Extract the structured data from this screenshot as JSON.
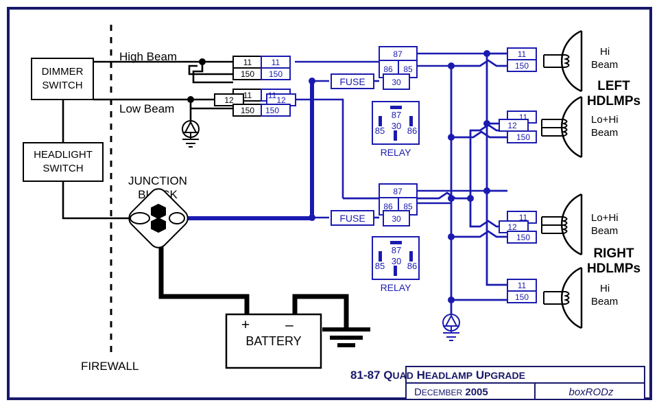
{
  "meta": {
    "border_color": "#18186a",
    "wire_black": "#000000",
    "wire_blue": "#1a1ab0",
    "bg": "#ffffff"
  },
  "left_panel": {
    "dimmer_switch": {
      "line1": "DIMMER",
      "line2": "SWITCH"
    },
    "headlight_switch": {
      "line1": "HEADLIGHT",
      "line2": "SWITCH"
    },
    "high_beam_label": "High Beam",
    "low_beam_label": "Low Beam",
    "junction_block": {
      "line1": "JUNCTION",
      "line2": "BLOCK"
    },
    "firewall_label": "FIREWALL",
    "battery": {
      "plus": "+",
      "minus": "–",
      "label": "BATTERY"
    }
  },
  "connectors": {
    "dimmer_high": {
      "top": "11",
      "bottom": "150"
    },
    "dimmer_low": {
      "top": "11",
      "mid": "12",
      "bottom": "150"
    },
    "harness_high": {
      "top": "11",
      "bottom": "150"
    },
    "harness_low": {
      "top": "11",
      "mid": "12",
      "bottom": "150"
    },
    "lamp_left_hi": {
      "top": "11",
      "bottom": "150"
    },
    "lamp_left_lohi": {
      "top": "11",
      "mid": "12",
      "bottom": "150"
    },
    "lamp_right_lohi": {
      "top": "11",
      "mid": "12",
      "bottom": "150"
    },
    "lamp_right_hi": {
      "top": "11",
      "bottom": "150"
    }
  },
  "fuses": {
    "upper_label": "FUSE",
    "lower_label": "FUSE"
  },
  "relays": [
    {
      "name": "upper-relay",
      "schematic_terminals": {
        "t87": "87",
        "t86": "86",
        "t85": "85",
        "t30": "30"
      },
      "pinout_terminals": {
        "t87": "87",
        "t85": "85",
        "t30": "30",
        "t86": "86"
      },
      "caption": "RELAY"
    },
    {
      "name": "lower-relay",
      "schematic_terminals": {
        "t87": "87",
        "t86": "86",
        "t85": "85",
        "t30": "30"
      },
      "pinout_terminals": {
        "t87": "87",
        "t85": "85",
        "t30": "30",
        "t86": "86"
      },
      "caption": "RELAY"
    }
  ],
  "lamps": [
    {
      "name": "left-hi",
      "beam_line1": "Hi",
      "beam_line2": "Beam",
      "filaments": 1
    },
    {
      "name": "left-lohi",
      "beam_line1": "Lo+Hi",
      "beam_line2": "Beam",
      "filaments": 2
    },
    {
      "name": "right-lohi",
      "beam_line1": "Lo+Hi",
      "beam_line2": "Beam",
      "filaments": 2
    },
    {
      "name": "right-hi",
      "beam_line1": "Hi",
      "beam_line2": "Beam",
      "filaments": 1
    }
  ],
  "lamp_groups": {
    "left": {
      "line1": "LEFT",
      "line2": "HDLMPs"
    },
    "right": {
      "line1": "RIGHT",
      "line2": "HDLMPs"
    }
  },
  "title_block": {
    "title_parts": [
      {
        "big": "81-87",
        "rest": ""
      },
      {
        "big": "Q",
        "rest": "UAD"
      },
      {
        "big": "H",
        "rest": "EADLAMP"
      },
      {
        "big": "U",
        "rest": "PGRADE"
      }
    ],
    "title_plain": "81-87 QUAD HEADLAMP UPGRADE",
    "date_month_cap": "D",
    "date_month_rest": "ECEMBER",
    "date_year": "2005",
    "author": "boxRODz"
  }
}
